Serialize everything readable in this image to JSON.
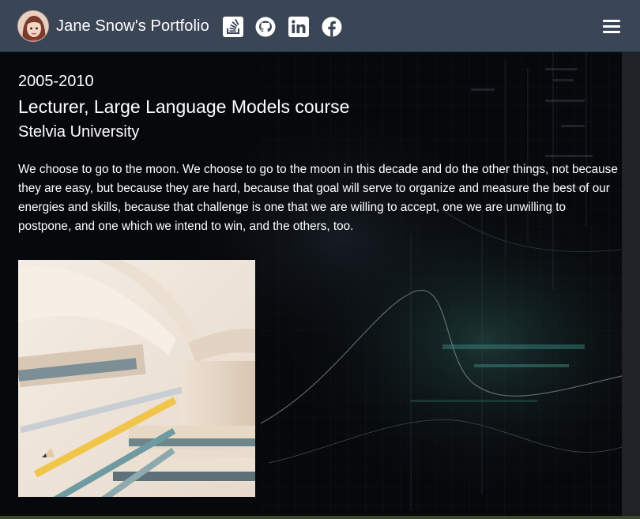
{
  "navbar": {
    "brand": "Jane Snow's Portfolio",
    "social_links": [
      {
        "name": "stack-overflow",
        "icon": "stack-overflow-icon"
      },
      {
        "name": "github",
        "icon": "github-icon"
      },
      {
        "name": "linkedin",
        "icon": "linkedin-icon"
      },
      {
        "name": "facebook",
        "icon": "facebook-icon"
      }
    ],
    "menu_icon": "hamburger-menu-icon",
    "background_color": "#3a4556"
  },
  "experience": {
    "period": "2005-2010",
    "role": "Lecturer, Large Language Models course",
    "organization": "Stelvia University",
    "description": "We choose to go to the moon. We choose to go to the moon in this decade and do the other things, not because they are easy, but because they are hard, because that goal will serve to organize and measure the best of our energies and skills, because that challenge is one that we are willing to accept, one we are unwilling to postpone, and one which we intend to win, and the others, too.",
    "image": "open-books-and-pencils-photo"
  }
}
